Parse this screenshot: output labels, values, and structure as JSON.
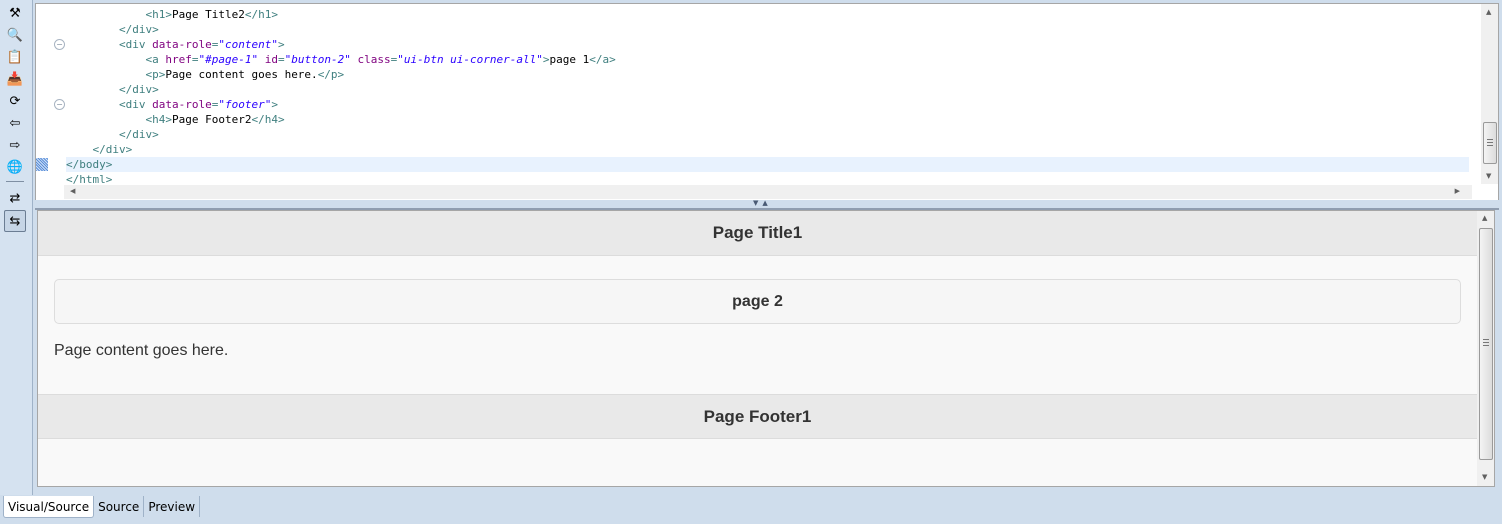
{
  "toolbar": {
    "icons": [
      {
        "name": "palette-tools-icon",
        "glyph": "⚒"
      },
      {
        "name": "css-preview-icon",
        "glyph": "🔍"
      },
      {
        "name": "import-icon",
        "glyph": "📋"
      },
      {
        "name": "export-icon",
        "glyph": "📥"
      },
      {
        "name": "refresh-icon",
        "glyph": "⟳"
      },
      {
        "name": "back-icon",
        "glyph": "⇦"
      },
      {
        "name": "forward-icon",
        "glyph": "⇨"
      },
      {
        "name": "globe-icon",
        "glyph": "🌐"
      },
      {
        "name": "sync-icon",
        "glyph": "⇄"
      },
      {
        "name": "sync-toggle-icon",
        "glyph": "⇆"
      }
    ]
  },
  "source": {
    "lines": [
      {
        "indent": "            ",
        "parts": [
          [
            "tag",
            "<h1>"
          ],
          [
            "text",
            "Page Title2"
          ],
          [
            "tag",
            "</h1>"
          ]
        ]
      },
      {
        "indent": "        ",
        "parts": [
          [
            "tag",
            "</div>"
          ]
        ]
      },
      {
        "indent": "        ",
        "parts": [
          [
            "tag",
            "<div "
          ],
          [
            "attr",
            "data-role"
          ],
          [
            "tag",
            "="
          ],
          [
            "val",
            "\"content\""
          ],
          [
            "tag",
            ">"
          ]
        ],
        "fold": true
      },
      {
        "indent": "            ",
        "parts": [
          [
            "tag",
            "<a "
          ],
          [
            "attr",
            "href"
          ],
          [
            "tag",
            "="
          ],
          [
            "val",
            "\"#page-1\""
          ],
          [
            "tag",
            " "
          ],
          [
            "attr",
            "id"
          ],
          [
            "tag",
            "="
          ],
          [
            "val",
            "\"button-2\""
          ],
          [
            "tag",
            " "
          ],
          [
            "attr",
            "class"
          ],
          [
            "tag",
            "="
          ],
          [
            "val",
            "\"ui-btn ui-corner-all\""
          ],
          [
            "tag",
            ">"
          ],
          [
            "text",
            "page 1"
          ],
          [
            "tag",
            "</a>"
          ]
        ]
      },
      {
        "indent": "            ",
        "parts": [
          [
            "tag",
            "<p>"
          ],
          [
            "text",
            "Page content goes here."
          ],
          [
            "tag",
            "</p>"
          ]
        ]
      },
      {
        "indent": "        ",
        "parts": [
          [
            "tag",
            "</div>"
          ]
        ]
      },
      {
        "indent": "        ",
        "parts": [
          [
            "tag",
            "<div "
          ],
          [
            "attr",
            "data-role"
          ],
          [
            "tag",
            "="
          ],
          [
            "val",
            "\"footer\""
          ],
          [
            "tag",
            ">"
          ]
        ],
        "fold": true
      },
      {
        "indent": "            ",
        "parts": [
          [
            "tag",
            "<h4>"
          ],
          [
            "text",
            "Page Footer2"
          ],
          [
            "tag",
            "</h4>"
          ]
        ]
      },
      {
        "indent": "        ",
        "parts": [
          [
            "tag",
            "</div>"
          ]
        ]
      },
      {
        "indent": "    ",
        "parts": [
          [
            "tag",
            "</div>"
          ]
        ]
      },
      {
        "indent": "",
        "parts": [
          [
            "tag",
            "</body>"
          ]
        ],
        "highlight": true
      },
      {
        "indent": "",
        "parts": [
          [
            "tag",
            "</html>"
          ]
        ]
      }
    ]
  },
  "visual": {
    "header_title": "Page Title1",
    "button_label": "page 2",
    "content_text": "Page content goes here.",
    "footer_title": "Page Footer1"
  },
  "tabs": [
    {
      "label": "Visual/Source",
      "active": true
    },
    {
      "label": "Source",
      "active": false
    },
    {
      "label": "Preview",
      "active": false
    }
  ]
}
